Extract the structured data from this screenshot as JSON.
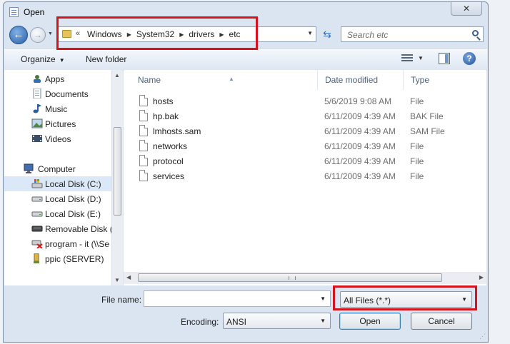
{
  "window": {
    "title": "Open",
    "close_glyph": "✕"
  },
  "nav": {
    "back_glyph": "←",
    "forward_glyph": "→",
    "more_glyph": "«",
    "breadcrumbs": [
      "Windows",
      "System32",
      "drivers",
      "etc"
    ],
    "refresh_glyph": "⇆",
    "search_placeholder": "Search etc"
  },
  "toolbar": {
    "organize_label": "Organize",
    "new_folder_label": "New folder",
    "help_glyph": "?"
  },
  "sidebar": {
    "items": [
      {
        "label": "Apps",
        "icon": "apps-icon"
      },
      {
        "label": "Documents",
        "icon": "documents-icon"
      },
      {
        "label": "Music",
        "icon": "music-icon"
      },
      {
        "label": "Pictures",
        "icon": "pictures-icon"
      },
      {
        "label": "Videos",
        "icon": "videos-icon"
      },
      {
        "label": "Computer",
        "icon": "computer-icon"
      },
      {
        "label": "Local Disk (C:)",
        "icon": "windows-drive-icon"
      },
      {
        "label": "Local Disk (D:)",
        "icon": "drive-icon"
      },
      {
        "label": "Local Disk (E:)",
        "icon": "drive-icon"
      },
      {
        "label": "Removable Disk (",
        "icon": "removable-drive-icon"
      },
      {
        "label": "program - it (\\\\Se",
        "icon": "disconnected-network-drive-icon"
      },
      {
        "label": "ppic (SERVER)",
        "icon": "network-drive-icon"
      }
    ],
    "selected": "Local Disk (C:)"
  },
  "columns": {
    "name": "Name",
    "date": "Date modified",
    "type": "Type"
  },
  "files": [
    {
      "name": "hosts",
      "date": "5/6/2019 9:08 AM",
      "type": "File"
    },
    {
      "name": "hp.bak",
      "date": "6/11/2009 4:39 AM",
      "type": "BAK File"
    },
    {
      "name": "lmhosts.sam",
      "date": "6/11/2009 4:39 AM",
      "type": "SAM File"
    },
    {
      "name": "networks",
      "date": "6/11/2009 4:39 AM",
      "type": "File"
    },
    {
      "name": "protocol",
      "date": "6/11/2009 4:39 AM",
      "type": "File"
    },
    {
      "name": "services",
      "date": "6/11/2009 4:39 AM",
      "type": "File"
    }
  ],
  "bottom": {
    "file_name_label": "File name:",
    "file_name_value": "",
    "file_type_value": "All Files  (*.*)",
    "encoding_label": "Encoding:",
    "encoding_value": "ANSI",
    "open_label": "Open",
    "cancel_label": "Cancel"
  },
  "colors": {
    "highlight": "#d4141c",
    "selection": "#dbe8f7",
    "accent": "#2a5fa8"
  }
}
